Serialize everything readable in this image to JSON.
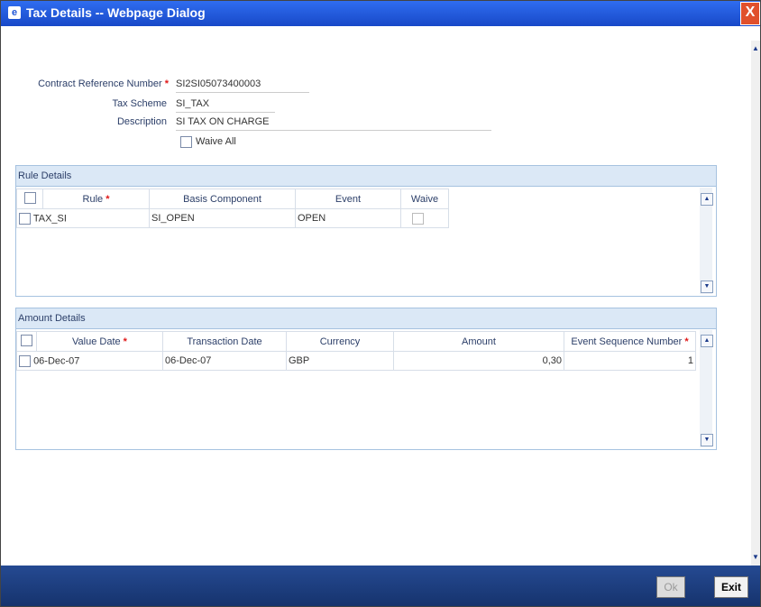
{
  "window": {
    "title": "Tax Details -- Webpage Dialog",
    "close_glyph": "X"
  },
  "form": {
    "contract_ref_label": "Contract Reference Number",
    "contract_ref_value": "SI2SI05073400003",
    "tax_scheme_label": "Tax Scheme",
    "tax_scheme_value": "SI_TAX",
    "description_label": "Description",
    "description_value": "SI TAX ON CHARGE",
    "waive_all_label": "Waive All"
  },
  "rule_details": {
    "title": "Rule Details",
    "headers": [
      "Rule",
      "Basis Component",
      "Event",
      "Waive"
    ],
    "rows": [
      {
        "rule": "TAX_SI",
        "basis_component": "SI_OPEN",
        "event": "OPEN"
      }
    ]
  },
  "amount_details": {
    "title": "Amount Details",
    "headers": [
      "Value Date",
      "Transaction Date",
      "Currency",
      "Amount",
      "Event Sequence Number"
    ],
    "rows": [
      {
        "value_date": "06-Dec-07",
        "transaction_date": "06-Dec-07",
        "currency": "GBP",
        "amount": "0,30",
        "event_seq": "1"
      }
    ]
  },
  "footer": {
    "ok_label": "Ok",
    "exit_label": "Exit"
  },
  "colors": {
    "titlebar": "#1f55d6",
    "footer": "#1c3d7e",
    "required": "#e01818"
  }
}
